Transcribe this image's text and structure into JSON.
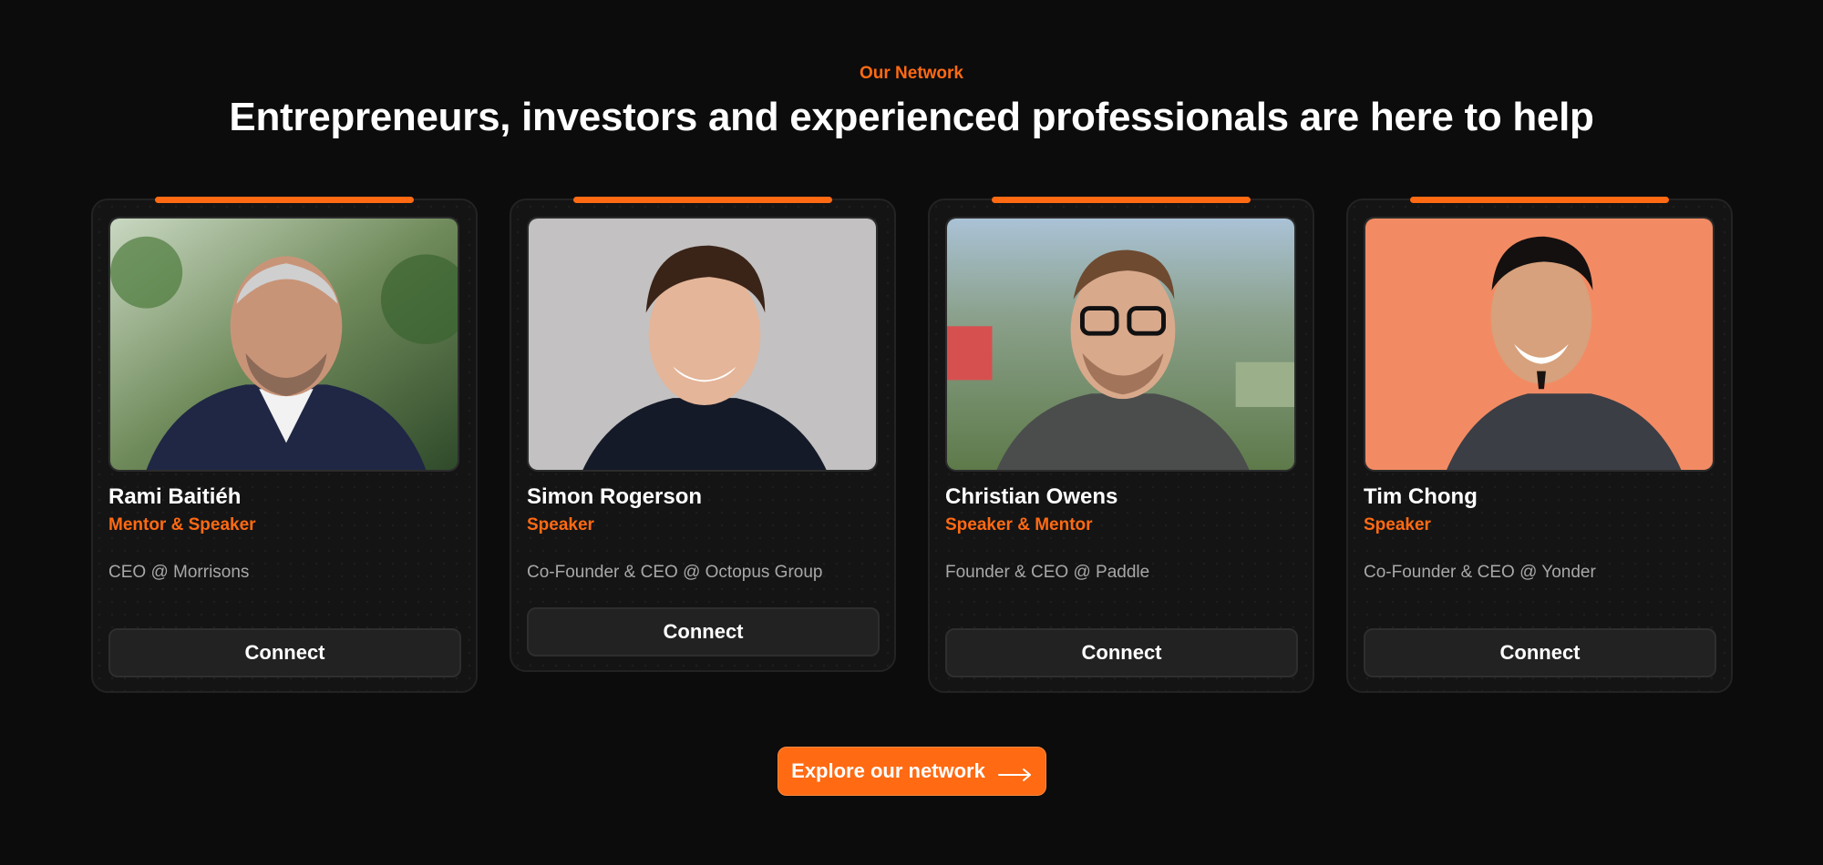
{
  "section": {
    "eyebrow": "Our Network",
    "headline": "Entrepreneurs, investors and experienced professionals are here to help"
  },
  "cards": [
    {
      "name": "Rami Baitiéh",
      "role": "Mentor & Speaker",
      "company": "CEO @ Morrisons",
      "button": "Connect",
      "photo_icon": "portrait-photo"
    },
    {
      "name": "Simon Rogerson",
      "role": "Speaker",
      "company": "Co-Founder & CEO @ Octopus Group",
      "button": "Connect",
      "photo_icon": "portrait-photo"
    },
    {
      "name": "Christian Owens",
      "role": "Speaker & Mentor",
      "company": "Founder & CEO @ Paddle",
      "button": "Connect",
      "photo_icon": "portrait-photo"
    },
    {
      "name": "Tim Chong",
      "role": "Speaker",
      "company": "Co-Founder & CEO @ Yonder",
      "button": "Connect",
      "photo_icon": "portrait-photo"
    }
  ],
  "cta": {
    "label": "Explore our network",
    "icon": "arrow-right-icon"
  },
  "colors": {
    "accent": "#ff6a13",
    "background": "#0c0c0d",
    "card": "#141414"
  }
}
